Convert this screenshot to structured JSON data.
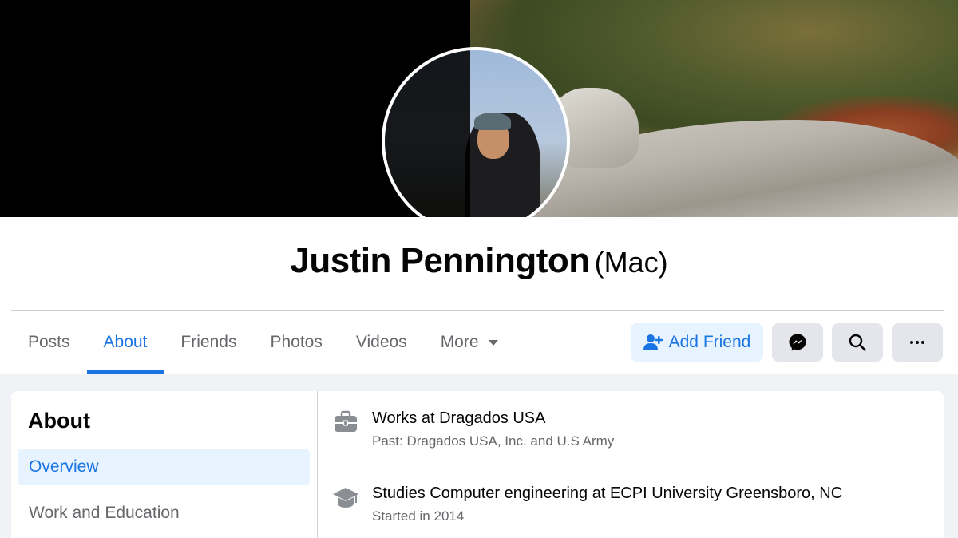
{
  "profile": {
    "name": "Justin Pennington",
    "alternate_name": "(Mac)"
  },
  "tabs": [
    {
      "label": "Posts",
      "active": false
    },
    {
      "label": "About",
      "active": true
    },
    {
      "label": "Friends",
      "active": false
    },
    {
      "label": "Photos",
      "active": false
    },
    {
      "label": "Videos",
      "active": false
    },
    {
      "label": "More",
      "active": false
    }
  ],
  "actions": {
    "add_friend_label": "Add Friend",
    "messenger_icon": "messenger-icon",
    "search_icon": "search-icon",
    "more_icon": "ellipsis-icon"
  },
  "about": {
    "title": "About",
    "sections": [
      {
        "label": "Overview",
        "active": true
      },
      {
        "label": "Work and Education",
        "active": false
      }
    ],
    "items": [
      {
        "icon": "briefcase-icon",
        "main": "Works at Dragados USA",
        "sub": "Past: Dragados USA, Inc. and U.S Army"
      },
      {
        "icon": "graduation-cap-icon",
        "main": "Studies Computer engineering at ECPI University Greensboro, NC",
        "sub": "Started in 2014"
      }
    ]
  },
  "colors": {
    "accent": "#1b74e4",
    "accent_light": "#e7f3ff",
    "text_secondary": "#65676b",
    "background": "#f0f2f5"
  }
}
